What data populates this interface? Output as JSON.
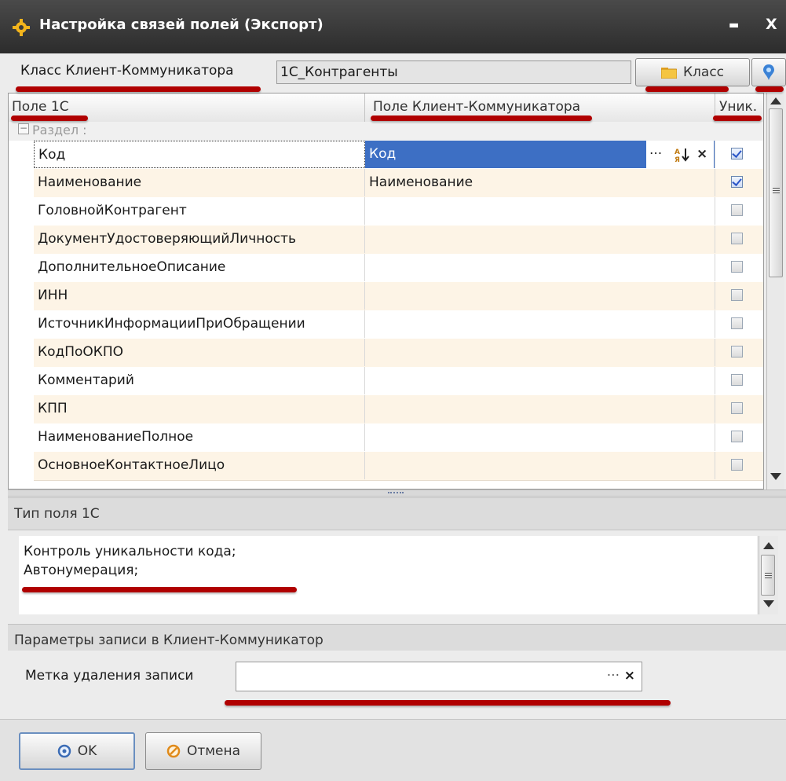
{
  "window": {
    "title": "Настройка связей полей (Экспорт)",
    "minimize_symbol": "▬",
    "close_symbol": "X"
  },
  "class_row": {
    "label": "Класс Клиент-Коммуникатора",
    "value": "1C_Контрагенты",
    "class_button_label": "Класс"
  },
  "grid": {
    "headers": [
      "Поле 1С",
      "Поле Клиент-Коммуникатора",
      "Уник."
    ],
    "group_label": "Раздел :",
    "rows": [
      {
        "field_1c": "Код",
        "field_kk": "Код",
        "unique": true
      },
      {
        "field_1c": "Наименование",
        "field_kk": "Наименование",
        "unique": true
      },
      {
        "field_1c": "ГоловнойКонтрагент",
        "field_kk": "",
        "unique": false
      },
      {
        "field_1c": "ДокументУдостоверяющийЛичность",
        "field_kk": "",
        "unique": false
      },
      {
        "field_1c": "ДополнительноеОписание",
        "field_kk": "",
        "unique": false
      },
      {
        "field_1c": "ИНН",
        "field_kk": "",
        "unique": false
      },
      {
        "field_1c": "ИсточникИнформацииПриОбращении",
        "field_kk": "",
        "unique": false
      },
      {
        "field_1c": "КодПоОКПО",
        "field_kk": "",
        "unique": false
      },
      {
        "field_1c": "Комментарий",
        "field_kk": "",
        "unique": false
      },
      {
        "field_1c": "КПП",
        "field_kk": "",
        "unique": false
      },
      {
        "field_1c": "НаименованиеПолное",
        "field_kk": "",
        "unique": false
      },
      {
        "field_1c": "ОсновноеКонтактноеЛицо",
        "field_kk": "",
        "unique": false
      }
    ],
    "editor_ellipsis": "···",
    "editor_clear": "×"
  },
  "type_section": {
    "title": "Тип поля 1С",
    "lines": [
      "Контроль уникальности кода;",
      "Автонумерация;"
    ]
  },
  "params_section": {
    "title": "Параметры записи в Клиент-Коммуникатор",
    "delete_mark_label": "Метка удаления записи",
    "delete_mark_value": "",
    "ellipsis": "···",
    "clear": "×"
  },
  "buttons": {
    "ok_label": "OK",
    "cancel_label": "Отмена"
  },
  "colors": {
    "annotation_red": "#b00000",
    "selection_blue": "#3d6fc4",
    "row_alt": "#fdf4e6"
  }
}
